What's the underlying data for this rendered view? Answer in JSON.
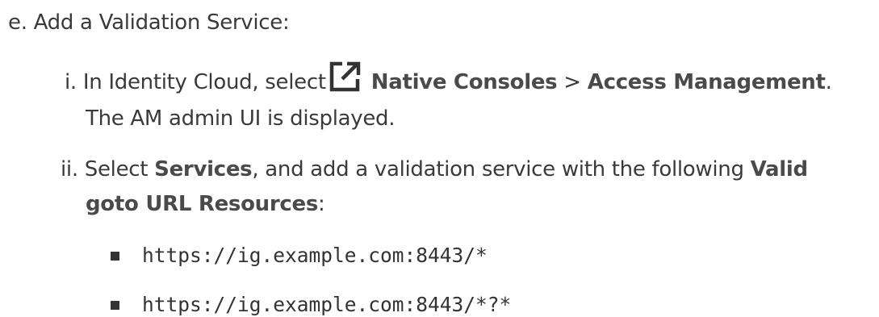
{
  "step_e": {
    "marker": "e.",
    "text": "Add a Validation Service:"
  },
  "substep_i": {
    "marker": "i.",
    "text_before": "In Identity Cloud, select",
    "icon": "external-link-icon",
    "bold_1": "Native Consoles",
    "separator": ">",
    "bold_2": "Access Management",
    "end_punct": ".",
    "line2": "The AM admin UI is displayed."
  },
  "substep_ii": {
    "marker": "ii.",
    "text_before": "Select",
    "bold_1": "Services",
    "text_middle": ", and add a validation service with the following",
    "bold_2a": "Valid",
    "bold_2b": "goto URL Resources",
    "end_punct": ":"
  },
  "urls": [
    "https://ig.example.com:8443/*",
    "https://ig.example.com:8443/*?*"
  ]
}
